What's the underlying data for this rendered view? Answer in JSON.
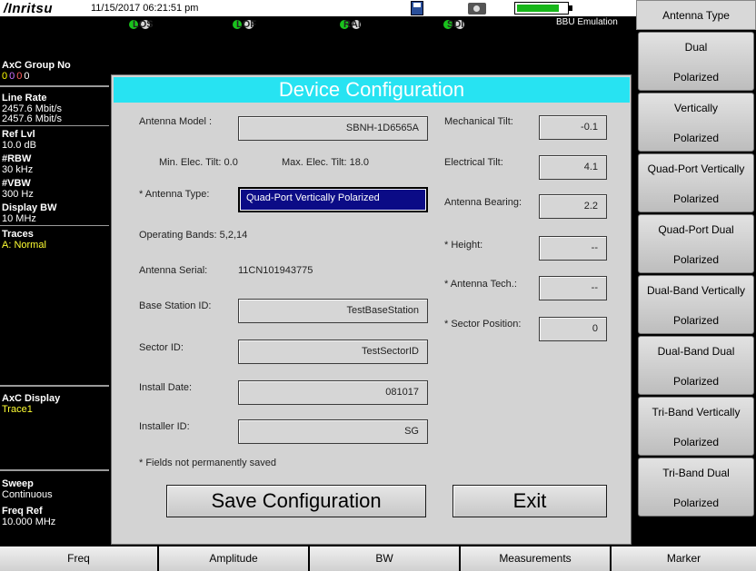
{
  "header": {
    "brand": "/Inritsu",
    "datetime": "11/15/2017 06:21:51 pm",
    "battery_level": 0.82,
    "indicators": [
      {
        "label": "LOS"
      },
      {
        "label": "LOF"
      },
      {
        "label": "RAI"
      },
      {
        "label": "SDI"
      }
    ],
    "mode": "BBU Emulation"
  },
  "left_panel": {
    "axc_group_label": "AxC Group No",
    "axc_group_digits": [
      "0",
      "0",
      "0",
      "0"
    ],
    "axc_group_colors": [
      "#ffff00",
      "#d070ff",
      "#ff6060",
      "#ffffff"
    ],
    "line_rate_label": "Line Rate",
    "line_rate_1": "2457.6 Mbit/s",
    "line_rate_2": "2457.6 Mbit/s",
    "ref_lvl_label": "Ref Lvl",
    "ref_lvl_value": "10.0 dB",
    "rbw_label": "#RBW",
    "rbw_value": "30 kHz",
    "vbw_label": "#VBW",
    "vbw_value": "300 Hz",
    "display_bw_label": "Display BW",
    "display_bw_value": "10 MHz",
    "traces_label": "Traces",
    "traces_value": "A: Normal",
    "axc_display_label": "AxC Display",
    "axc_display_value": "Trace1",
    "sweep_label": "Sweep",
    "sweep_value": "Continuous",
    "freq_ref_label": "Freq Ref",
    "freq_ref_value": "10.000 MHz"
  },
  "right_panel": {
    "title": "Antenna Type",
    "keys": [
      {
        "line1": "Dual",
        "line2": "Polarized"
      },
      {
        "line1": "Vertically",
        "line2": "Polarized"
      },
      {
        "line1": "Quad-Port Vertically",
        "line2": "Polarized"
      },
      {
        "line1": "Quad-Port Dual",
        "line2": "Polarized"
      },
      {
        "line1": "Dual-Band Vertically",
        "line2": "Polarized"
      },
      {
        "line1": "Dual-Band Dual",
        "line2": "Polarized"
      },
      {
        "line1": "Tri-Band Vertically",
        "line2": "Polarized"
      },
      {
        "line1": "Tri-Band Dual",
        "line2": "Polarized"
      }
    ]
  },
  "bottom_tabs": [
    "Freq",
    "Amplitude",
    "BW",
    "Measurements",
    "Marker"
  ],
  "dialog": {
    "title": "Device Configuration",
    "antenna_model_label": "Antenna Model :",
    "antenna_model_value": "SBNH-1D6565A",
    "min_tilt": "Min. Elec. Tilt: 0.0",
    "max_tilt": "Max. Elec. Tilt: 18.0",
    "antenna_type_label": "* Antenna Type:",
    "antenna_type_value": "Quad-Port Vertically Polarized",
    "operating_bands": "Operating Bands: 5,2,14",
    "antenna_serial_label": "Antenna Serial:",
    "antenna_serial_value": "11CN101943775",
    "base_station_label": "Base Station ID:",
    "base_station_value": "TestBaseStation",
    "sector_id_label": "Sector ID:",
    "sector_id_value": "TestSectorID",
    "install_date_label": "Install Date:",
    "install_date_value": "081017",
    "installer_id_label": "Installer ID:",
    "installer_id_value": "SG",
    "mech_tilt_label": "Mechanical Tilt:",
    "mech_tilt_value": "-0.1",
    "elec_tilt_label": "Electrical Tilt:",
    "elec_tilt_value": "4.1",
    "bearing_label": "Antenna Bearing:",
    "bearing_value": "2.2",
    "height_label": "* Height:",
    "height_value": "--",
    "tech_label": "* Antenna Tech.:",
    "tech_value": "--",
    "sector_pos_label": "* Sector Position:",
    "sector_pos_value": "0",
    "footnote": "* Fields not permanently saved",
    "save_label": "Save Configuration",
    "exit_label": "Exit"
  }
}
